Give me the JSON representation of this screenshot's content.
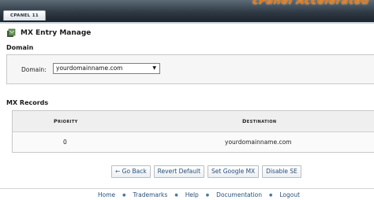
{
  "header": {
    "brand": "CPANEL 11",
    "logo_text": "cPanel Accelerated"
  },
  "page": {
    "title": "MX Entry Manage",
    "icon": "mx-entry-icon"
  },
  "domain_section": {
    "heading": "Domain",
    "field_label": "Domain:",
    "selected_value": "yourdomainname.com"
  },
  "records_section": {
    "heading": "MX Records",
    "columns": [
      "Priority",
      "Destination"
    ],
    "rows": [
      {
        "priority": "0",
        "destination": "yourdomainname.com"
      }
    ]
  },
  "actions": {
    "go_back": "← Go Back",
    "revert_default": "Revert Default",
    "set_google_mx": "Set Google MX",
    "disable_se": "Disable SE"
  },
  "footer": {
    "links": [
      "Home",
      "Trademarks",
      "Help",
      "Documentation",
      "Logout"
    ]
  },
  "colors": {
    "link": "#27507a",
    "header_dark": "#2f3a45",
    "logo_orange": "#e07a1f"
  }
}
